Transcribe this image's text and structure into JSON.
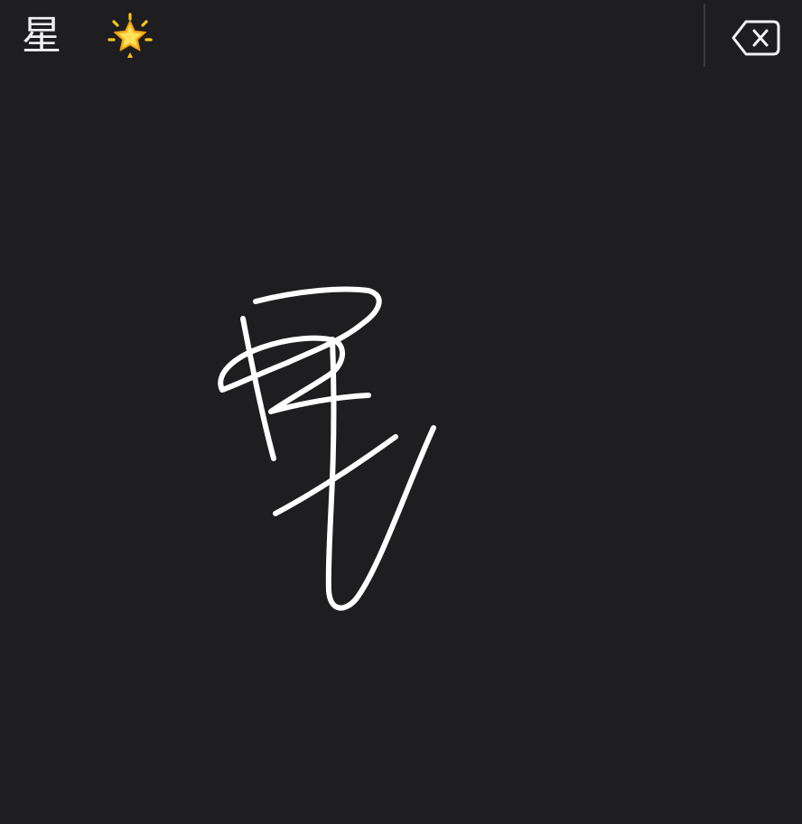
{
  "candidates": [
    {
      "text": "星"
    },
    {
      "icon": "glowing-star-emoji",
      "color": "#f6b41c"
    }
  ],
  "delete_key": {
    "icon": "backspace-delete-icon"
  },
  "handwriting": {
    "stroke_color": "#ffffff"
  },
  "colors": {
    "background": "#1e1d20",
    "text": "#f2f2f2",
    "divider": "#3a3a3c"
  }
}
